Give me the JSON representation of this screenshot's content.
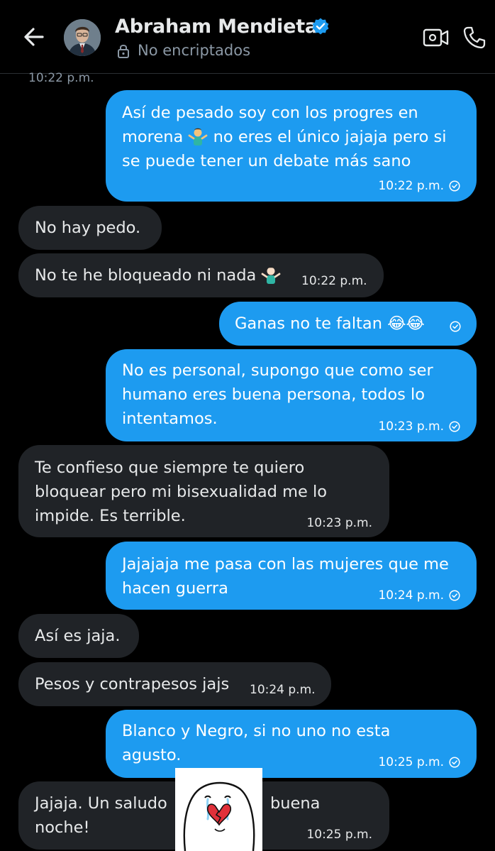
{
  "header": {
    "contact_name": "Abraham Mendieta",
    "encryption_status": "No encriptados"
  },
  "top_timestamp": "10:22 p.m.",
  "messages": [
    {
      "direction": "out",
      "lines": [
        "Así de pesado soy con los progres en",
        "morena {emoji} no eres el único jajaja pero si",
        "se puede tener un debate más sano"
      ],
      "time": "10:22 p.m."
    },
    {
      "direction": "in",
      "lines": [
        "No hay pedo."
      ],
      "time": ""
    },
    {
      "direction": "in",
      "lines": [
        "No te he bloqueado ni nada {emoji}"
      ],
      "time": "10:22 p.m."
    },
    {
      "direction": "out",
      "lines": [
        "Ganas no te faltan 😂😂"
      ],
      "time": ""
    },
    {
      "direction": "out",
      "lines": [
        "No es personal, supongo que como ser",
        "humano eres buena persona, todos lo",
        "intentamos."
      ],
      "time": "10:23 p.m."
    },
    {
      "direction": "in",
      "lines": [
        "Te confieso que siempre te quiero",
        "bloquear pero mi bisexualidad me lo",
        "impide. Es terrible."
      ],
      "time": "10:23 p.m."
    },
    {
      "direction": "out",
      "lines": [
        "Jajajaja me pasa con las mujeres que me",
        "hacen guerra"
      ],
      "time": "10:24 p.m."
    },
    {
      "direction": "in",
      "lines": [
        "Así es jaja."
      ],
      "time": ""
    },
    {
      "direction": "in",
      "lines": [
        "Pesos y contrapesos jajs"
      ],
      "time": "10:24 p.m."
    },
    {
      "direction": "out",
      "lines": [
        "Blanco y Negro, si no uno no esta",
        "agusto."
      ],
      "time": "10:25 p.m."
    },
    {
      "direction": "in",
      "lines": [
        "Jajaja. Un saludo",
        "noche!"
      ],
      "extra_text": "buena",
      "time": "10:25 p.m."
    }
  ],
  "colors": {
    "outgoing_bubble": "#1d9bf0",
    "incoming_bubble": "#202327",
    "background": "#000000",
    "verified_badge": "#1d9bf0"
  },
  "icons": {
    "back": "back-arrow-icon",
    "verified": "verified-badge-icon",
    "lock": "lock-icon",
    "video": "video-call-icon",
    "phone": "phone-call-icon",
    "sent_check": "sent-check-icon",
    "shrug_emoji": "person-shrugging-emoji",
    "laugh_emoji": "tears-of-joy-emoji"
  }
}
